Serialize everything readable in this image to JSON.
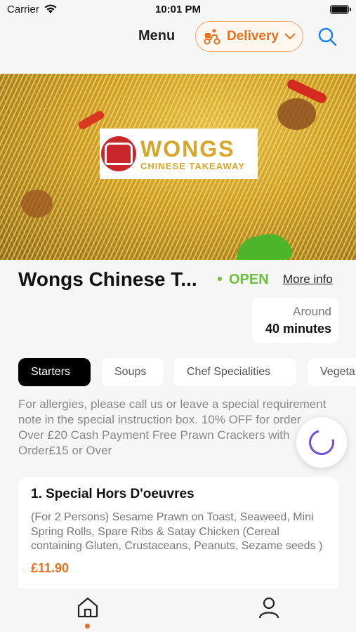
{
  "status_bar": {
    "carrier": "Carrier",
    "time": "10:01 PM"
  },
  "nav": {
    "title": "Menu",
    "delivery_label": "Delivery"
  },
  "hero": {
    "logo_name": "WONGS",
    "logo_subtitle": "CHINESE TAKEAWAY"
  },
  "restaurant": {
    "name": "Wongs Chinese T...",
    "status": "OPEN",
    "more_info": "More info",
    "eta_label": "Around",
    "eta_value": "40 minutes"
  },
  "category_tabs": [
    {
      "label": "Starters",
      "active": true
    },
    {
      "label": "Soups",
      "active": false
    },
    {
      "label": "Chef Specialities",
      "active": false
    },
    {
      "label": "Vegeta",
      "active": false
    }
  ],
  "note": "For allergies, please call us or leave a special requirement note in the special instruction box. 10% OFF for order Over £20 Cash Payment Free Prawn Crackers with Order£15 or Over",
  "menu_items": [
    {
      "name": "1. Special Hors D'oeuvres",
      "description": "(For 2 Persons) Sesame Prawn on Toast, Seaweed, Mini Spring Rolls, Spare Ribs & Satay Chicken (Cereal containing Gluten, Crustaceans, Peanuts, Sezame seeds )",
      "price": "£11.90"
    }
  ],
  "tabbar": {
    "active": "home"
  },
  "colors": {
    "accent": "#e8701e",
    "open": "#6cbf3c",
    "spinner": "#6f4fd8",
    "link_blue": "#1a7ff0"
  }
}
